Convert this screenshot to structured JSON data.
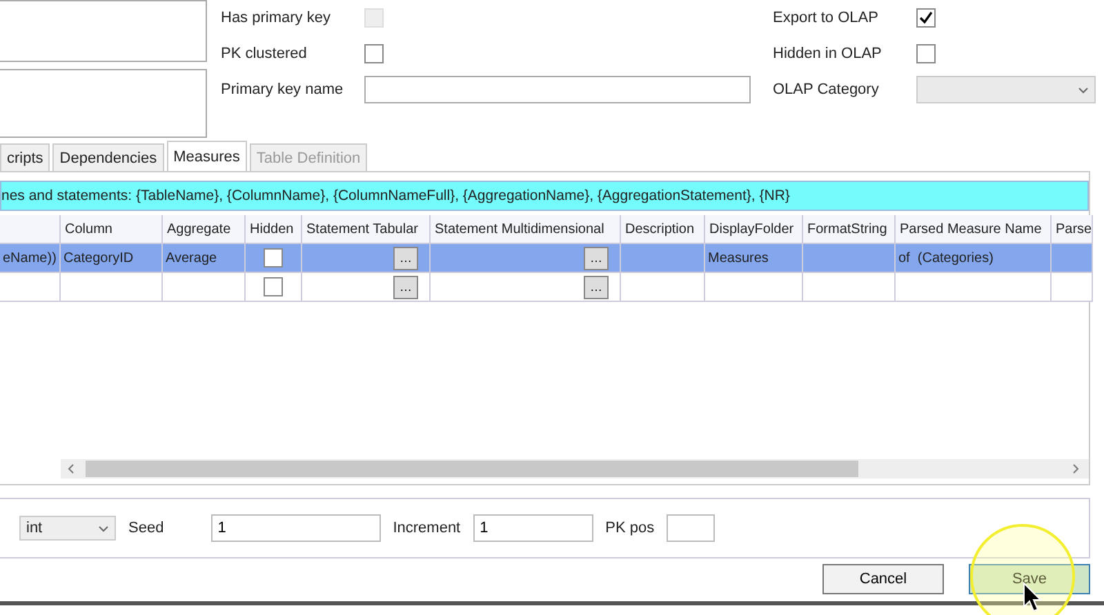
{
  "properties": {
    "left": [
      {
        "label": "Has primary key",
        "kind": "checkbox",
        "checked": false,
        "disabled": true
      },
      {
        "label": "PK clustered",
        "kind": "checkbox",
        "checked": false,
        "disabled": false
      },
      {
        "label": "Primary key name",
        "kind": "text"
      }
    ],
    "right": [
      {
        "label": "Export to OLAP",
        "kind": "checkbox",
        "checked": true,
        "disabled": false
      },
      {
        "label": "Hidden in OLAP",
        "kind": "checkbox",
        "checked": false,
        "disabled": false
      },
      {
        "label": "OLAP Category",
        "kind": "dropdown"
      }
    ]
  },
  "tabs": [
    {
      "label": "cripts",
      "selected": false,
      "disabled": false
    },
    {
      "label": "Dependencies",
      "selected": false,
      "disabled": false
    },
    {
      "label": "Measures",
      "selected": true,
      "disabled": false
    },
    {
      "label": "Table Definition",
      "selected": false,
      "disabled": true
    }
  ],
  "hint": "nes and statements: {TableName}, {ColumnName}, {ColumnNameFull}, {AggregationName}, {AggregationStatement}, {NR}",
  "table": {
    "columns": [
      "",
      "Column",
      "Aggregate",
      "Hidden",
      "Statement Tabular",
      "Statement Multidimensional",
      "Description",
      "DisplayFolder",
      "FormatString",
      "Parsed Measure Name",
      "Parse"
    ],
    "rows": [
      {
        "selected": true,
        "hidden": false,
        "cells": [
          "eName))",
          "CategoryID",
          "Average",
          "",
          "…",
          "…",
          "",
          "Measures",
          "",
          "of  (Categories)",
          ""
        ]
      },
      {
        "selected": false,
        "hidden": false,
        "cells": [
          "",
          "",
          "",
          "",
          "…",
          "…",
          "",
          "",
          "",
          "",
          ""
        ]
      }
    ]
  },
  "identity": {
    "type": "int",
    "seed_label": "Seed",
    "seed": "1",
    "increment_label": "Increment",
    "increment": "1",
    "pkpos_label": "PK pos"
  },
  "buttons": [
    {
      "label": "Cancel",
      "kind": "normal"
    },
    {
      "label": "Save",
      "kind": "hover"
    }
  ]
}
